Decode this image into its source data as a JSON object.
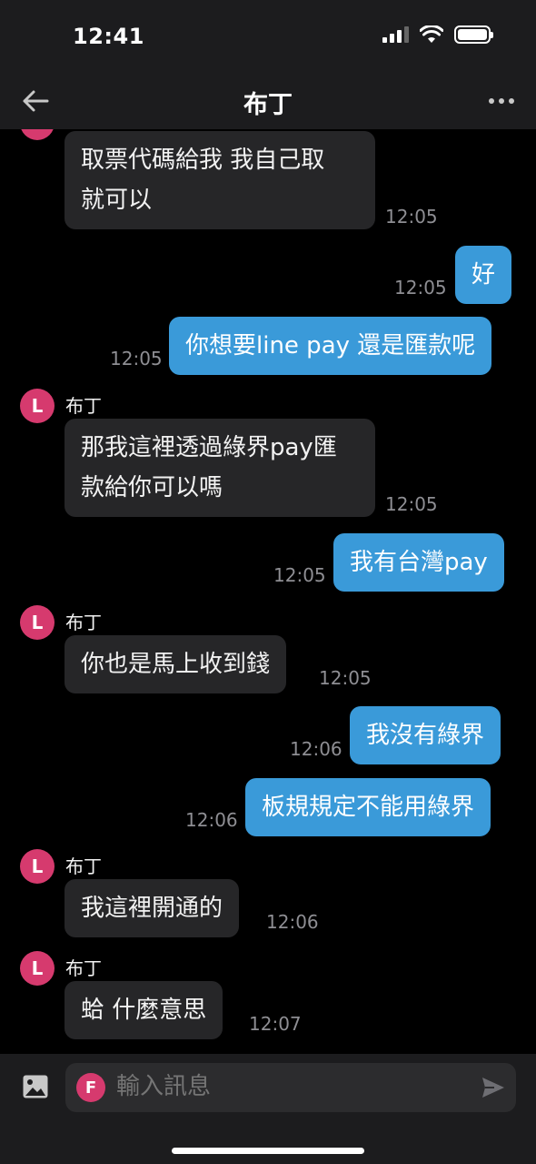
{
  "status": {
    "time": "12:41"
  },
  "header": {
    "title": "布丁"
  },
  "chat": {
    "sender_name": "布丁",
    "sender_initial": "L",
    "messages": [
      {
        "dir": "in",
        "text": "取票代碼給我 我自己取\n就可以",
        "time": "12:05"
      },
      {
        "dir": "out",
        "text": "好",
        "time": "12:05"
      },
      {
        "dir": "out",
        "text": "你想要line pay 還是匯款呢",
        "time": "12:05"
      },
      {
        "dir": "in",
        "text": "那我這裡透過綠界pay匯\n款給你可以嗎",
        "time": "12:05"
      },
      {
        "dir": "out",
        "text": "我有台灣pay",
        "time": "12:05"
      },
      {
        "dir": "in",
        "text": "你也是馬上收到錢",
        "time": "12:05"
      },
      {
        "dir": "out",
        "text": "我沒有綠界",
        "time": "12:06"
      },
      {
        "dir": "out",
        "text": "板規規定不能用綠界",
        "time": "12:06"
      },
      {
        "dir": "in",
        "text": "我這裡開通的",
        "time": "12:06"
      },
      {
        "dir": "in",
        "text": "蛤 什麼意思",
        "time": "12:07"
      }
    ]
  },
  "input": {
    "placeholder": "輸入訊息",
    "user_initial": "F"
  },
  "colors": {
    "outgoing_bubble": "#3a9ad9",
    "incoming_bubble": "#262628",
    "avatar": "#d63a6e"
  },
  "icons": [
    "back-arrow-icon",
    "more-icon",
    "image-icon",
    "send-icon"
  ]
}
